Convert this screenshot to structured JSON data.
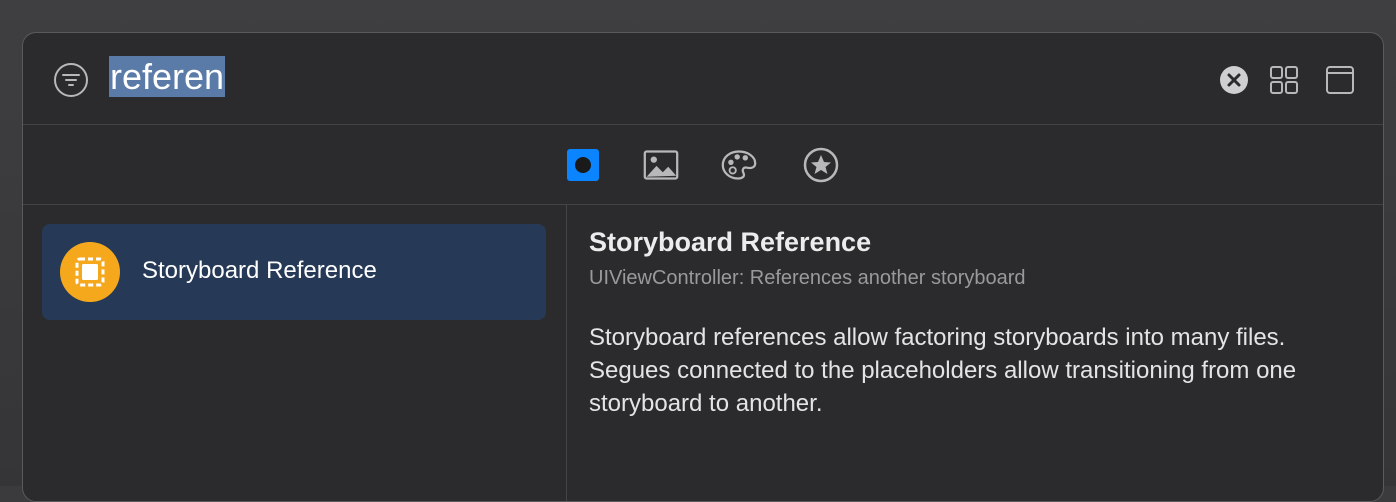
{
  "search": {
    "query": "referen"
  },
  "tabs": [
    {
      "icon": "objects-icon",
      "selected": true
    },
    {
      "icon": "image-icon",
      "selected": false
    },
    {
      "icon": "palette-icon",
      "selected": false
    },
    {
      "icon": "favorites-star-icon",
      "selected": false
    }
  ],
  "results": [
    {
      "label": "Storyboard Reference",
      "icon": "storyboard-reference-icon",
      "selected": true
    }
  ],
  "detail": {
    "title": "Storyboard Reference",
    "subtitle": "UIViewController: References another storyboard",
    "description": "Storyboard references allow factoring storyboards into many files. Segues connected to the placeholders allow transitioning from one storyboard to another."
  },
  "colors": {
    "accent": "#0a84ff",
    "selection": "#263a57",
    "item_icon_bg": "#f6a81c"
  }
}
